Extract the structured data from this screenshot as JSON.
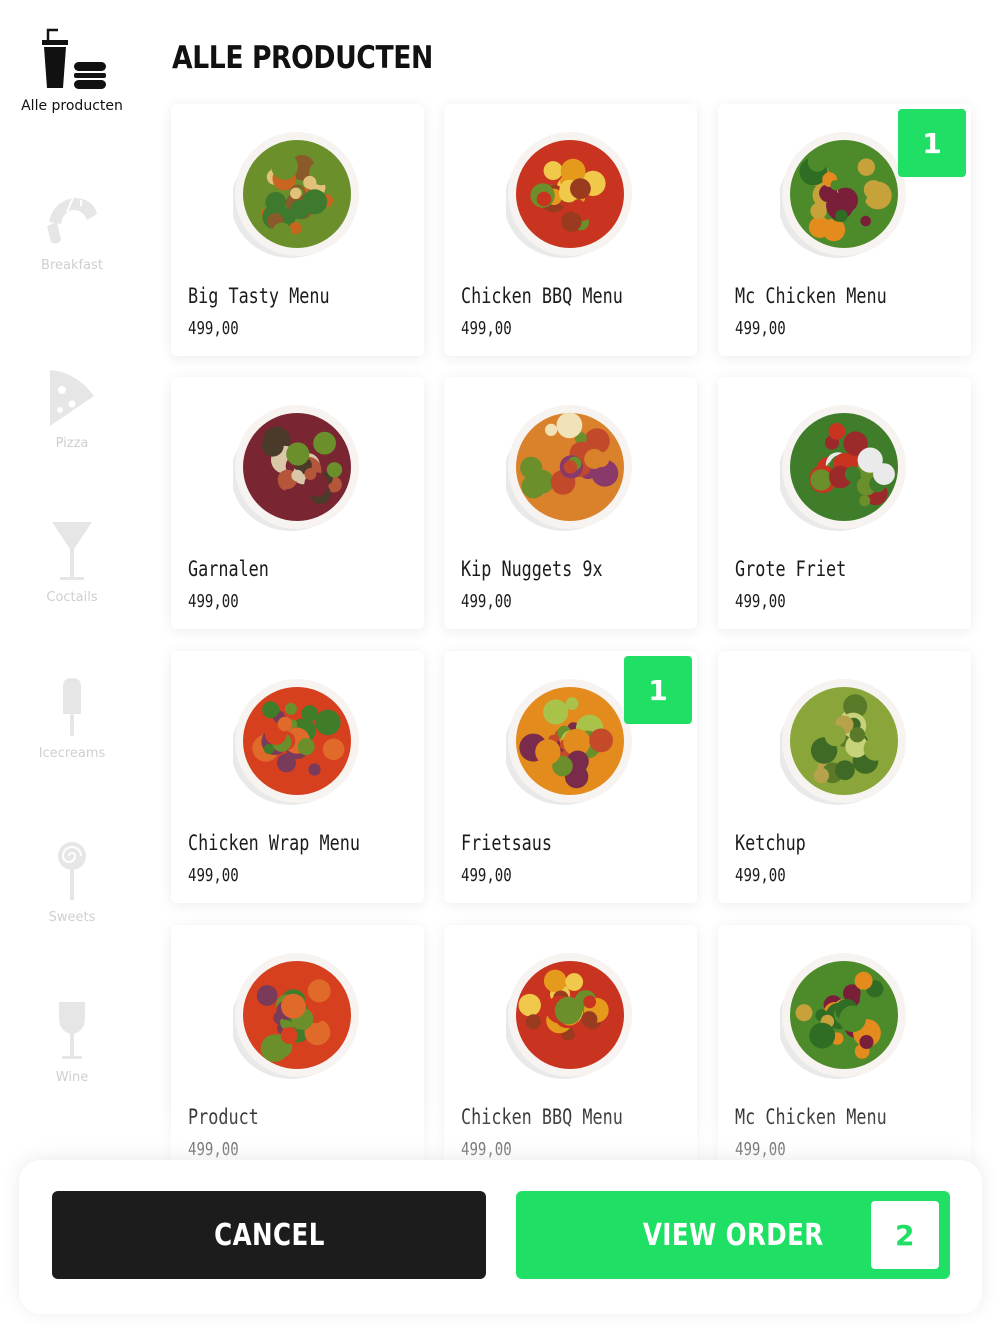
{
  "sidebar": {
    "categories": [
      {
        "label": "Alle producten",
        "icon": "drink-burger-icon",
        "active": true
      },
      {
        "label": "Breakfast",
        "icon": "croissant-icon",
        "active": false
      },
      {
        "label": "Pizza",
        "icon": "pizza-slice-icon",
        "active": false
      },
      {
        "label": "Coctails",
        "icon": "cocktail-glass-icon",
        "active": false
      },
      {
        "label": "Icecreams",
        "icon": "popsicle-icon",
        "active": false
      },
      {
        "label": "Sweets",
        "icon": "lollipop-icon",
        "active": false
      },
      {
        "label": "Wine",
        "icon": "wine-glass-icon",
        "active": false
      }
    ]
  },
  "main": {
    "title": "ALLE PRODUCTEN",
    "products": [
      {
        "name": "Big Tasty Menu",
        "price": "499,00"
      },
      {
        "name": "Chicken BBQ Menu",
        "price": "499,00"
      },
      {
        "name": "Mc Chicken Menu",
        "price": "499,00",
        "quantity": "1"
      },
      {
        "name": "Garnalen",
        "price": "499,00"
      },
      {
        "name": "Kip Nuggets 9x",
        "price": "499,00"
      },
      {
        "name": "Grote Friet",
        "price": "499,00"
      },
      {
        "name": "Chicken Wrap Menu",
        "price": "499,00"
      },
      {
        "name": "Frietsaus",
        "price": "499,00",
        "quantity": "1"
      },
      {
        "name": "Ketchup",
        "price": "499,00"
      },
      {
        "name": "Product",
        "price": "499,00"
      },
      {
        "name": "Chicken BBQ Menu",
        "price": "499,00"
      },
      {
        "name": "Mc Chicken Menu",
        "price": "499,00"
      }
    ]
  },
  "footer": {
    "cancel_label": "CANCEL",
    "view_order_label": "VIEW ORDER",
    "order_count": "2"
  },
  "colors": {
    "accent": "#1fdf64",
    "dark": "#1c1c1c",
    "inactive": "#cfcfcf"
  }
}
